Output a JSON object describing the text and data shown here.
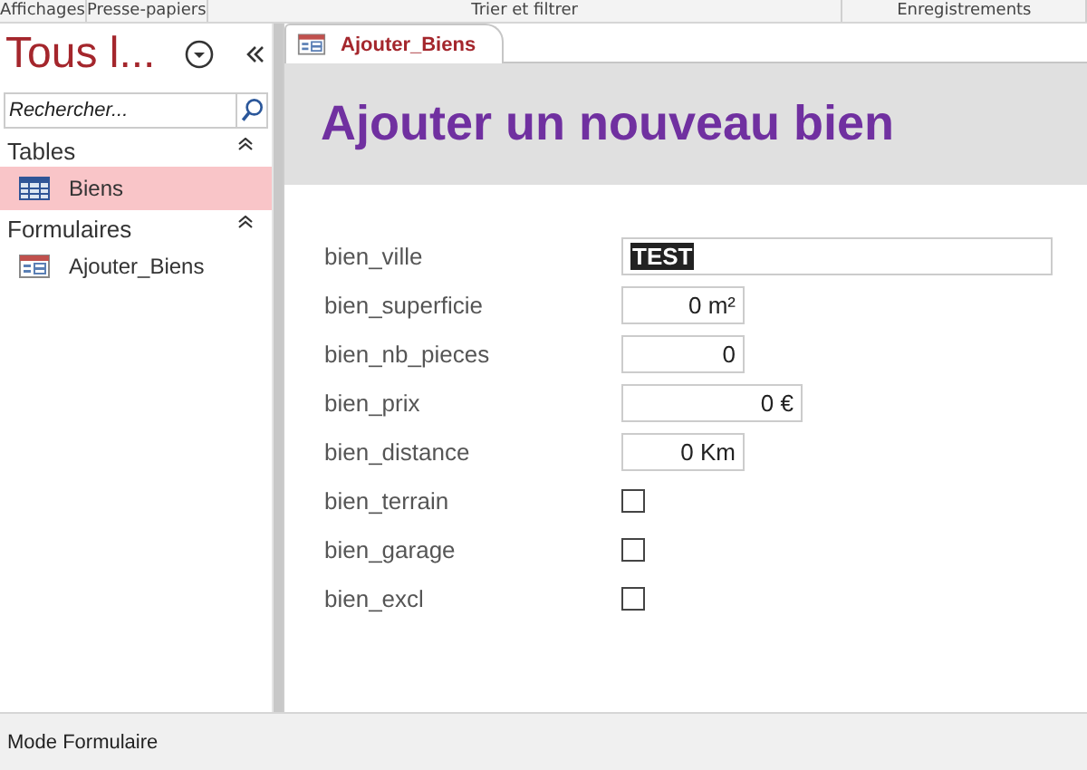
{
  "ribbon": {
    "groups": [
      "Affichages",
      "Presse-papiers",
      "Trier et filtrer",
      "Enregistrements"
    ]
  },
  "nav": {
    "title": "Tous l...",
    "search": {
      "placeholder": "Rechercher..."
    },
    "sections": [
      {
        "label": "Tables",
        "expanded": true,
        "items": [
          {
            "label": "Biens",
            "kind": "table",
            "selected": true
          }
        ]
      },
      {
        "label": "Formulaires",
        "expanded": true,
        "items": [
          {
            "label": "Ajouter_Biens",
            "kind": "form",
            "selected": false
          }
        ]
      }
    ]
  },
  "tabs": [
    {
      "label": "Ajouter_Biens",
      "selected": true
    }
  ],
  "form": {
    "title": "Ajouter un nouveau bien",
    "fields": [
      {
        "label": "bien_ville",
        "kind": "text",
        "value": "TEST",
        "value_selected": true
      },
      {
        "label": "bien_superficie",
        "kind": "number",
        "value": "0 m²",
        "value_selected": false
      },
      {
        "label": "bien_nb_pieces",
        "kind": "number",
        "value": "0",
        "value_selected": false
      },
      {
        "label": "bien_prix",
        "kind": "currency",
        "value": "0 €",
        "value_selected": false
      },
      {
        "label": "bien_distance",
        "kind": "number",
        "value": "0 Km",
        "value_selected": false
      },
      {
        "label": "bien_terrain",
        "kind": "checkbox",
        "checked": false
      },
      {
        "label": "bien_garage",
        "kind": "checkbox",
        "checked": false
      },
      {
        "label": "bien_excl",
        "kind": "checkbox",
        "checked": false
      }
    ]
  },
  "status_bar": {
    "text": "Mode Formulaire"
  }
}
